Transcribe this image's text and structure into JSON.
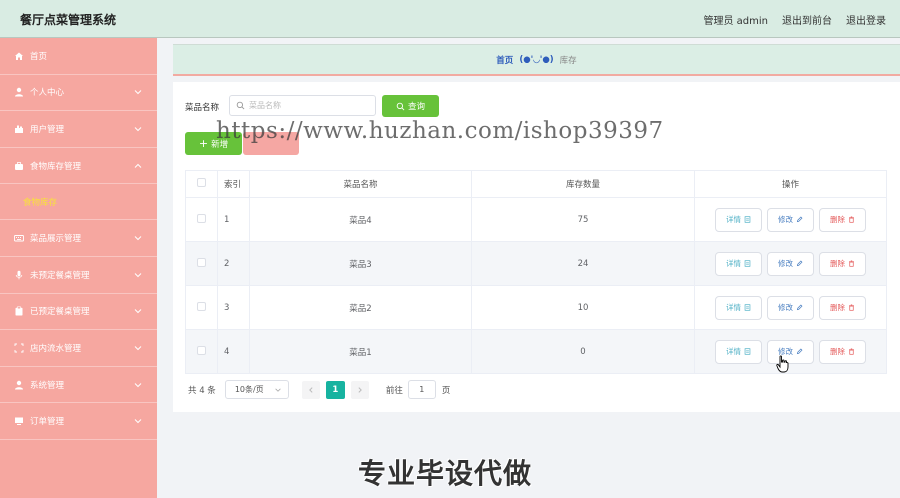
{
  "header": {
    "title": "餐厅点菜管理系统",
    "admin_label": "管理员 admin",
    "front_link": "退出到前台",
    "logout_link": "退出登录"
  },
  "sidebar": {
    "items": [
      {
        "label": "首页",
        "icon": "home-icon"
      },
      {
        "label": "个人中心",
        "icon": "user-icon"
      },
      {
        "label": "用户管理",
        "icon": "users-icon"
      },
      {
        "label": "食物库存管理",
        "icon": "briefcase-icon",
        "expanded": true
      },
      {
        "label": "菜品展示管理",
        "icon": "keyboard-icon"
      },
      {
        "label": "未预定餐桌管理",
        "icon": "mic-icon"
      },
      {
        "label": "已预定餐桌管理",
        "icon": "clipboard-icon"
      },
      {
        "label": "店内流水管理",
        "icon": "crop-icon"
      },
      {
        "label": "系统管理",
        "icon": "person-icon"
      },
      {
        "label": "订单管理",
        "icon": "monitor-icon"
      }
    ],
    "sub_item": "食物库存"
  },
  "breadcrumb": {
    "home": "首页",
    "separator": "(●'◡'●)",
    "current": "库存"
  },
  "search": {
    "label": "菜品名称",
    "placeholder": "菜品名称",
    "button": "查询"
  },
  "actions": {
    "add": "新增"
  },
  "watermark": "https://www.huzhan.com/ishop39397",
  "table": {
    "columns": [
      "索引",
      "菜品名称",
      "库存数量",
      "操作"
    ],
    "rows": [
      {
        "index": "1",
        "name": "菜品4",
        "stock": "75"
      },
      {
        "index": "2",
        "name": "菜品3",
        "stock": "24"
      },
      {
        "index": "3",
        "name": "菜品2",
        "stock": "10"
      },
      {
        "index": "4",
        "name": "菜品1",
        "stock": "0"
      }
    ],
    "ops": {
      "detail": "详情",
      "edit": "修改",
      "delete": "删除"
    }
  },
  "pagination": {
    "total": "共 4 条",
    "page_size": "10条/页",
    "current_page": "1",
    "goto_label": "前往",
    "goto_value": "1",
    "page_unit": "页"
  },
  "promo": "专业毕设代做",
  "colors": {
    "topbar": "#d9ece3",
    "sidebar": "#f6a7a0",
    "submenu_active": "#f8e23a",
    "primary_green": "#67c23a",
    "page_active": "#17b3a0"
  }
}
